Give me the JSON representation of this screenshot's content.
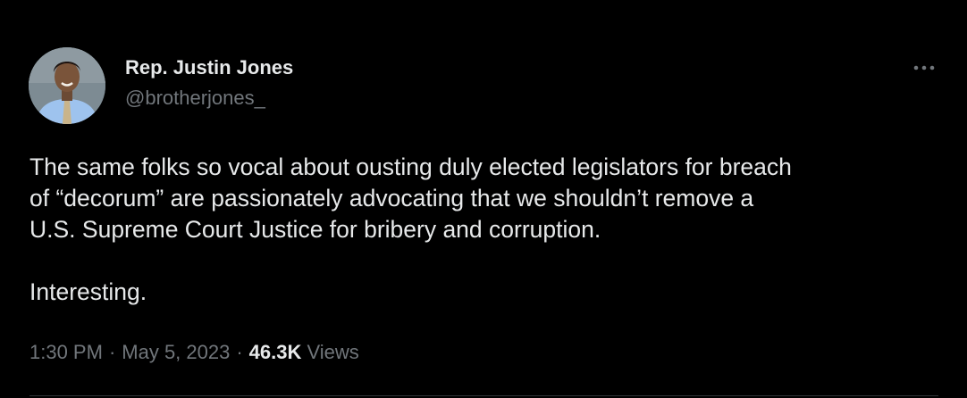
{
  "author": {
    "display_name": "Rep. Justin Jones",
    "handle": "@brotherjones_"
  },
  "tweet": {
    "paragraphs": [
      "The same folks so vocal about ousting duly elected legislators for breach\nof “decorum” are passionately advocating that we shouldn’t remove a\nU.S. Supreme Court Justice for bribery and corruption.",
      "Interesting."
    ],
    "time": "1:30 PM",
    "date": "May 5, 2023",
    "separator": "·",
    "views_count": "46.3K",
    "views_label": "Views"
  },
  "icons": {
    "more": "more-horizontal-icon"
  },
  "colors": {
    "background": "#000000",
    "primary_text": "#e7e9ea",
    "secondary_text": "#71767b",
    "divider": "#2f3336"
  }
}
